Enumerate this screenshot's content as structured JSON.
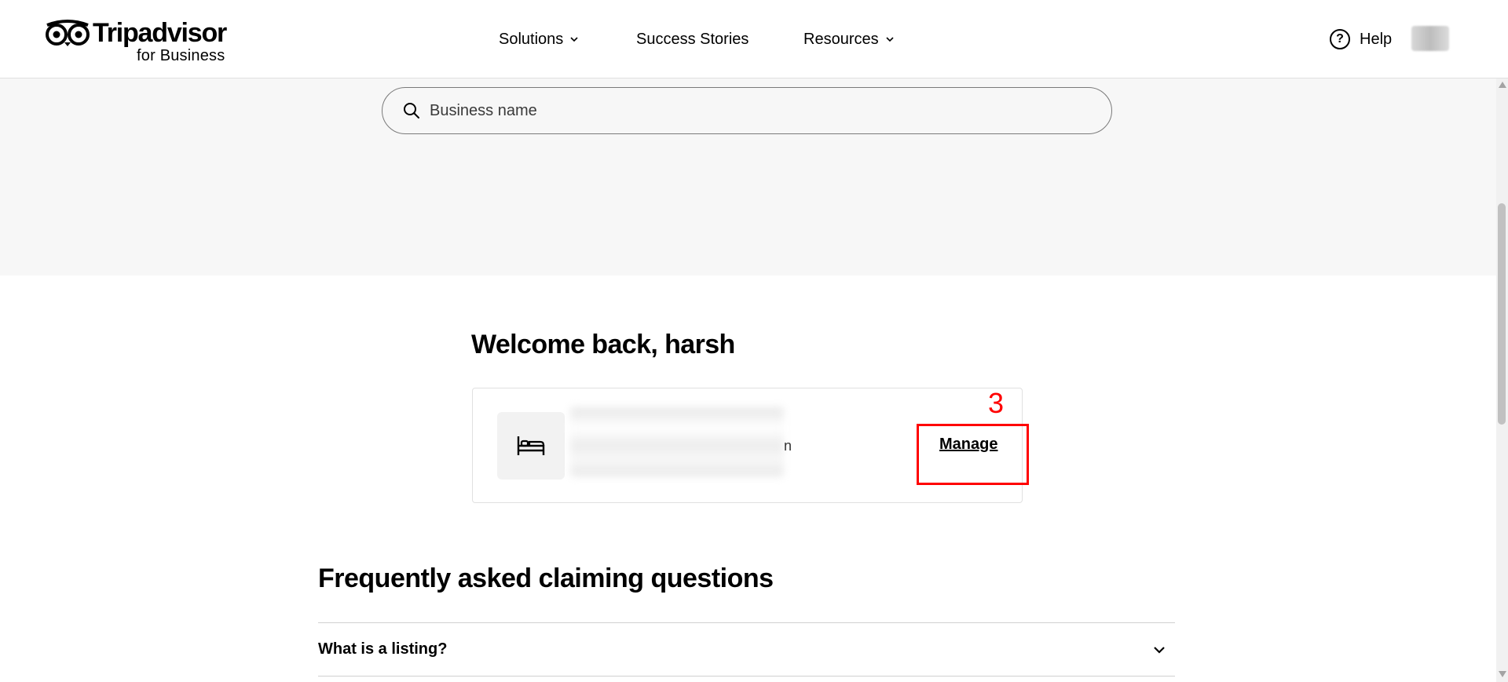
{
  "header": {
    "logo_word": "Tripadvisor",
    "logo_sub": "for Business",
    "nav": [
      {
        "label": "Solutions",
        "has_dropdown": true
      },
      {
        "label": "Success Stories",
        "has_dropdown": false
      },
      {
        "label": "Resources",
        "has_dropdown": true
      }
    ],
    "help_label": "Help",
    "help_icon": "question-circle-icon"
  },
  "search": {
    "placeholder": "Business name",
    "icon": "search-icon"
  },
  "welcome": {
    "title": "Welcome back, harsh"
  },
  "listing_card": {
    "icon": "bed-icon",
    "name_suffix": "n",
    "manage_label": "Manage"
  },
  "annotation": {
    "label": "3",
    "color": "#ff0000"
  },
  "faq": {
    "title": "Frequently asked claiming questions",
    "items": [
      {
        "question": "What is a listing?"
      }
    ]
  },
  "colors": {
    "text": "#000000",
    "hero_bg": "#f7f7f7",
    "border": "#e0e0e0"
  }
}
